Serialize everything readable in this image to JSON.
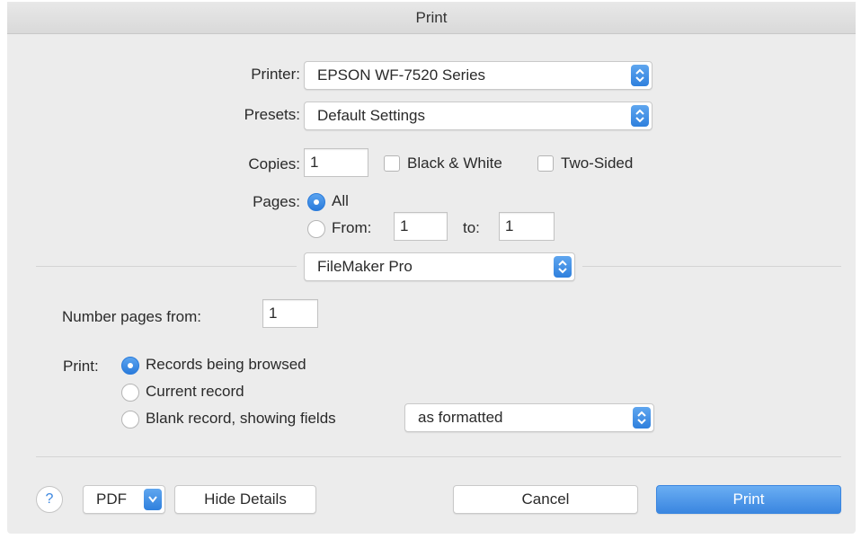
{
  "window": {
    "title": "Print"
  },
  "printer": {
    "label": "Printer:",
    "value": "EPSON WF-7520 Series"
  },
  "presets": {
    "label": "Presets:",
    "value": "Default Settings"
  },
  "copies": {
    "label": "Copies:",
    "value": "1",
    "black_white_label": "Black & White",
    "black_white_checked": false,
    "two_sided_label": "Two-Sided",
    "two_sided_checked": false
  },
  "pages": {
    "label": "Pages:",
    "all_label": "All",
    "all_selected": true,
    "from_label": "From:",
    "from_value": "1",
    "to_label": "to:",
    "to_value": "1"
  },
  "app_menu": {
    "value": "FileMaker Pro"
  },
  "number_pages": {
    "label": "Number pages from:",
    "value": "1"
  },
  "print_options": {
    "label": "Print:",
    "options": [
      "Records being browsed",
      "Current record",
      "Blank record, showing fields"
    ],
    "selected_index": 0,
    "fields_format": "as formatted"
  },
  "footer": {
    "help_label": "?",
    "pdf_label": "PDF",
    "hide_details_label": "Hide Details",
    "cancel_label": "Cancel",
    "print_label": "Print"
  },
  "colors": {
    "accent": "#3a86e0",
    "window_bg": "#ececec"
  }
}
